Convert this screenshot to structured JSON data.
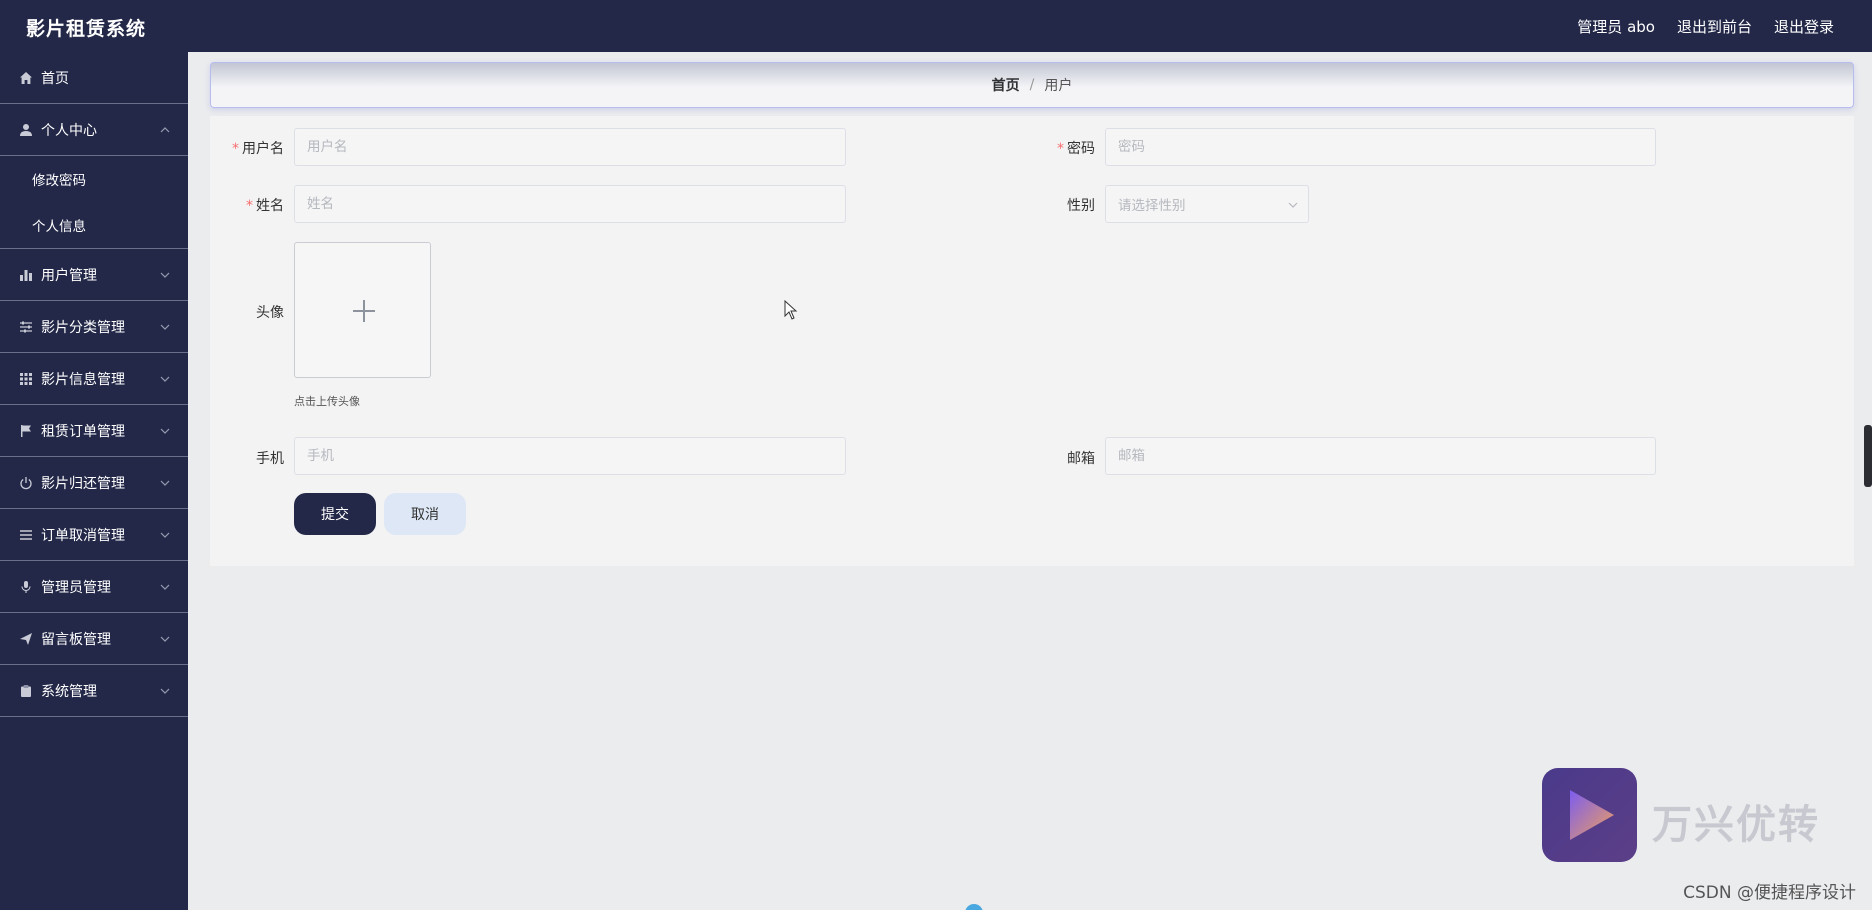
{
  "app": {
    "title": "影片租赁系统"
  },
  "top_links": {
    "user": "管理员 abo",
    "front": "退出到前台",
    "logout": "退出登录"
  },
  "sidebar": {
    "home": "首页",
    "personal": {
      "label": "个人中心",
      "children": [
        "修改密码",
        "个人信息"
      ]
    },
    "items": [
      "用户管理",
      "影片分类管理",
      "影片信息管理",
      "租赁订单管理",
      "影片归还管理",
      "订单取消管理",
      "管理员管理",
      "留言板管理",
      "系统管理"
    ]
  },
  "breadcrumb": {
    "home": "首页",
    "separator": "/",
    "current": "用户"
  },
  "form": {
    "username": {
      "label": "用户名",
      "placeholder": "用户名",
      "required": "*"
    },
    "password": {
      "label": "密码",
      "placeholder": "密码",
      "required": "*"
    },
    "name": {
      "label": "姓名",
      "placeholder": "姓名",
      "required": "*"
    },
    "gender": {
      "label": "性别",
      "placeholder": "请选择性别"
    },
    "avatar": {
      "label": "头像",
      "tip": "点击上传头像"
    },
    "phone": {
      "label": "手机",
      "placeholder": "手机"
    },
    "email": {
      "label": "邮箱",
      "placeholder": "邮箱"
    },
    "submit": "提交",
    "cancel": "取消"
  },
  "watermark": {
    "brand": "万兴优转",
    "credit": "CSDN @便捷程序设计"
  },
  "colors": {
    "nav_bg": "#232848",
    "required": "#f56c6c",
    "cancel_bg": "#dde7f5"
  }
}
